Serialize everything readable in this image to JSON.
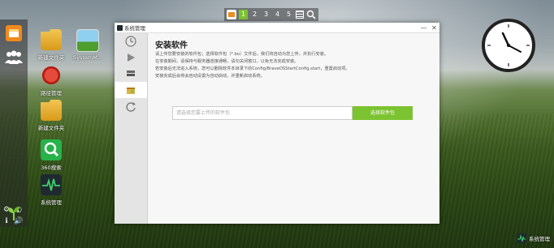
{
  "desktop": {
    "icons": [
      {
        "label": "新建文件夹"
      },
      {
        "label": "SystemM..."
      },
      {
        "label": "路径管理"
      },
      {
        "label": "新建文件夹"
      },
      {
        "label": "360搜索"
      },
      {
        "label": "系统管理"
      }
    ]
  },
  "pager": {
    "pages": [
      "1",
      "2",
      "3",
      "4",
      "5"
    ],
    "active": "1"
  },
  "window": {
    "title": "系统管理",
    "controls": {
      "minimize": "—",
      "close": "✕"
    },
    "heading": "安装软件",
    "description": [
      "请上传您要安装的软件包，选择软件包（*.bo）文件后，我们将自动为您上传，并执行安装。",
      "在安装期间，请保持与服务器连接通畅，请勿关闭窗口，以免无法完成安装。",
      "若安装后无法进入系统，您可以删除软件本目录下的Config/BraveOSStartConfig.start，重置启动项。",
      "安装完成后会将会自动设置为自动启动，并重新启动系统。"
    ],
    "upload_placeholder": "请选择您要上传的软件包",
    "upload_button": "选择软件包"
  },
  "brand": {
    "label": "系统管理"
  },
  "colors": {
    "accent": "#7cc331"
  }
}
